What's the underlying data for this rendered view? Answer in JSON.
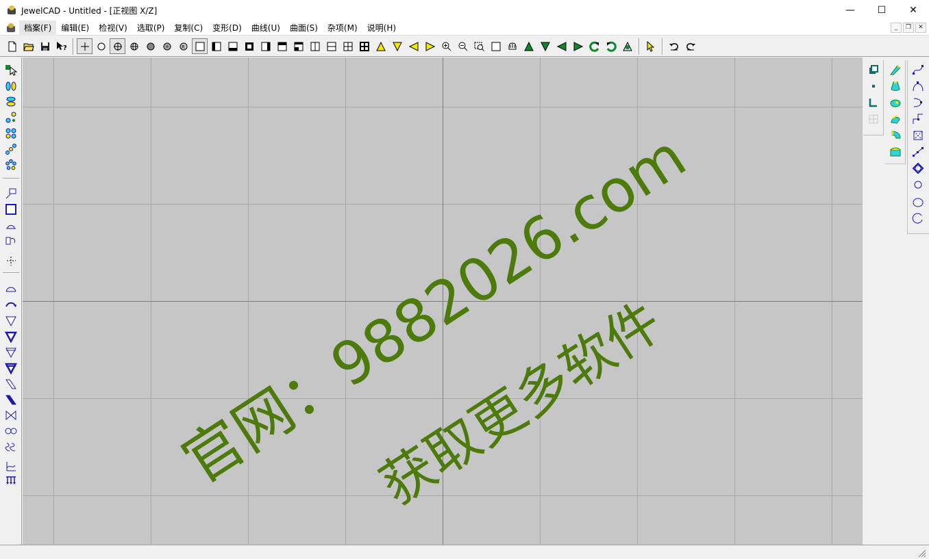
{
  "window": {
    "title": "JewelCAD - Untitled - [正视图 X/Z]",
    "minimize": "—",
    "maximize": "☐",
    "close": "✕"
  },
  "menu": {
    "items": [
      {
        "id": "file",
        "label": "档案(F)"
      },
      {
        "id": "edit",
        "label": "编辑(E)"
      },
      {
        "id": "view",
        "label": "检视(V)"
      },
      {
        "id": "select",
        "label": "选取(P)"
      },
      {
        "id": "copy",
        "label": "复制(C)"
      },
      {
        "id": "deform",
        "label": "变形(D)"
      },
      {
        "id": "curve",
        "label": "曲线(U)"
      },
      {
        "id": "surface",
        "label": "曲面(S)"
      },
      {
        "id": "misc",
        "label": "杂项(M)"
      },
      {
        "id": "help",
        "label": "说明(H)"
      }
    ],
    "mdi_minimize": "_",
    "mdi_restore": "❐",
    "mdi_close": "✕"
  },
  "watermark": {
    "line1": "官网：9882026.com",
    "line2": "获取更多软件"
  },
  "colors": {
    "canvas": "#c6c6c6",
    "grid_line": "#a8a8a8",
    "axis_line": "#7a7a7a",
    "watermark": "#4c7a0b",
    "tool_green": "#0a8a2a",
    "tool_yellow": "#f2e600",
    "tool_blue": "#1a1ab0",
    "tool_cyan": "#30d0e0"
  }
}
